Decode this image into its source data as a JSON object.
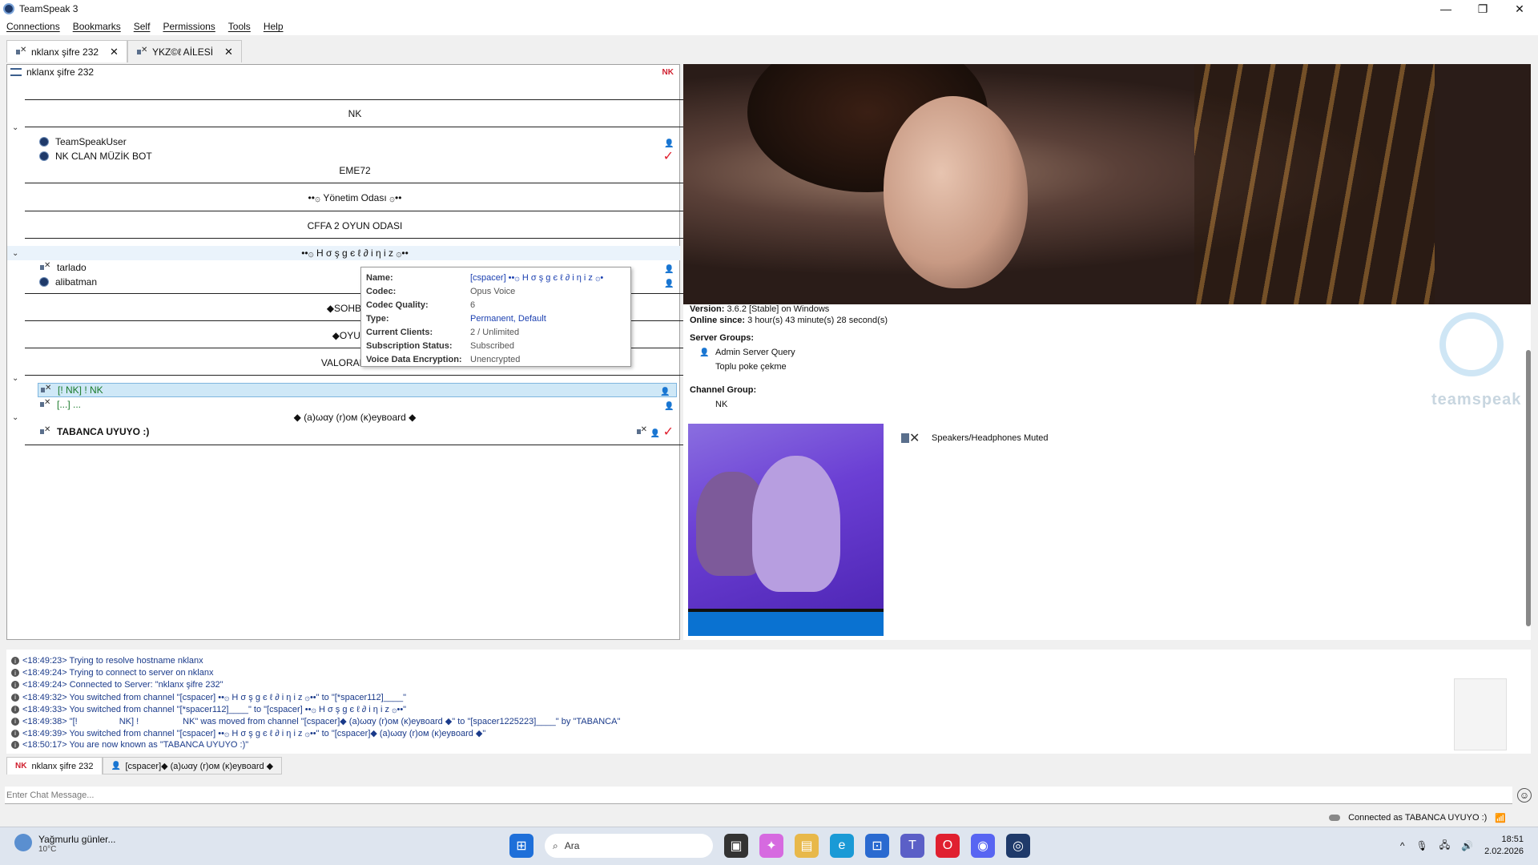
{
  "window": {
    "title": "TeamSpeak 3"
  },
  "menu": [
    "Connections",
    "Bookmarks",
    "Self",
    "Permissions",
    "Tools",
    "Help"
  ],
  "tabs": [
    {
      "label": "nklanx şifre 232",
      "active": true
    },
    {
      "label": "YKZ©ℓ AİLESİ",
      "active": false
    }
  ],
  "tree": {
    "server": "nklanx şifre 232",
    "server_badge": "NK",
    "channels": {
      "nk": "NK",
      "eme72": "EME72",
      "yonetim": "••۞ Yönetim Odası ۞••",
      "cffa": "CFFA 2 OYUN ODASI",
      "hosgeldiniz": "••۞ H σ ş g є ℓ ∂ i η i z ۞••",
      "sohbet": "◆SOHBET C",
      "oyun": "◆OYUN O",
      "valorant": "VALORANT OY",
      "away": "◆ (a)ωαу (r)ом (κ)eувoard ◆"
    },
    "users": {
      "teamspeakuser": "TeamSpeakUser",
      "musicbot": "NK CLAN MÜZİK BOT",
      "tarlado": "tarlado",
      "alibatman": "alibatman",
      "nk_user": "[!                 NK] !                  NK",
      "dots_user": "[...] ...",
      "tabanca": "TABANCA UYUYO :)"
    }
  },
  "tooltip": {
    "rows": [
      {
        "k": "Name:",
        "v": "[cspacer] ••۞ H σ ş g є ℓ ∂ i η i z ۞•"
      },
      {
        "k": "Codec:",
        "v": "Opus Voice"
      },
      {
        "k": "Codec Quality:",
        "v": "6"
      },
      {
        "k": "Type:",
        "v": "Permanent, Default"
      },
      {
        "k": "Current Clients:",
        "v": "2 / Unlimited"
      },
      {
        "k": "Subscription Status:",
        "v": "Subscribed"
      },
      {
        "k": "Voice Data Encryption:",
        "v": "Unencrypted"
      }
    ]
  },
  "info": {
    "version_label": "Version:",
    "version_value": "3.6.2 [Stable] on Windows",
    "online_label": "Online since:",
    "online_value": "3 hour(s) 43 minute(s) 28 second(s)",
    "server_groups_label": "Server Groups:",
    "server_groups": [
      "Admin Server Query",
      "Toplu poke çekme"
    ],
    "channel_group_label": "Channel Group:",
    "channel_group": "NK",
    "muted_status": "Speakers/Headphones Muted",
    "logo_text": "teamspeak"
  },
  "log": [
    "<18:49:23> Trying to resolve hostname nklanx",
    "<18:49:24> Trying to connect to server on nklanx",
    "<18:49:24> Connected to Server: \"nklanx şifre 232\"",
    "<18:49:32> You switched from channel \"[cspacer] ••۞ H σ ş g є ℓ ∂ i η i z ۞••\" to \"[*spacer112]____\"",
    "<18:49:33> You switched from channel \"[*spacer112]____\" to \"[cspacer] ••۞ H σ ş g є ℓ ∂ i η i z ۞••\"",
    "<18:49:38> \"[!                 NK] !                  NK\" was moved from channel \"[cspacer]◆ (a)ωαу (r)ом (κ)eувoard ◆\" to \"[spacer1225223]____\" by \"TABANCA\"",
    "<18:49:39> You switched from channel \"[cspacer] ••۞ H σ ş g є ℓ ∂ i η i z ۞••\" to \"[cspacer]◆ (a)ωαу (r)ом (κ)eувoard ◆\"",
    "<18:50:17> You are now known as \"TABANCA UYUYO :)\""
  ],
  "chat_tabs": [
    {
      "badge": "NK",
      "label": "nklanx şifre 232"
    },
    {
      "label": "[cspacer]◆ (a)ωαу (r)ом (κ)eувoard ◆"
    }
  ],
  "chat": {
    "placeholder": "Enter Chat Message..."
  },
  "status": {
    "connected": "Connected as TABANCA UYUYO :)"
  },
  "taskbar": {
    "weather_title": "Yağmurlu günler...",
    "weather_temp": "10°C",
    "search_placeholder": "Ara",
    "time": "18:51",
    "date": "2.02.2026"
  },
  "colors": {
    "accent": "#0a72d1",
    "badge_red": "#d0202f",
    "log_blue": "#1a3a8a",
    "selection": "#cfe8f7"
  }
}
